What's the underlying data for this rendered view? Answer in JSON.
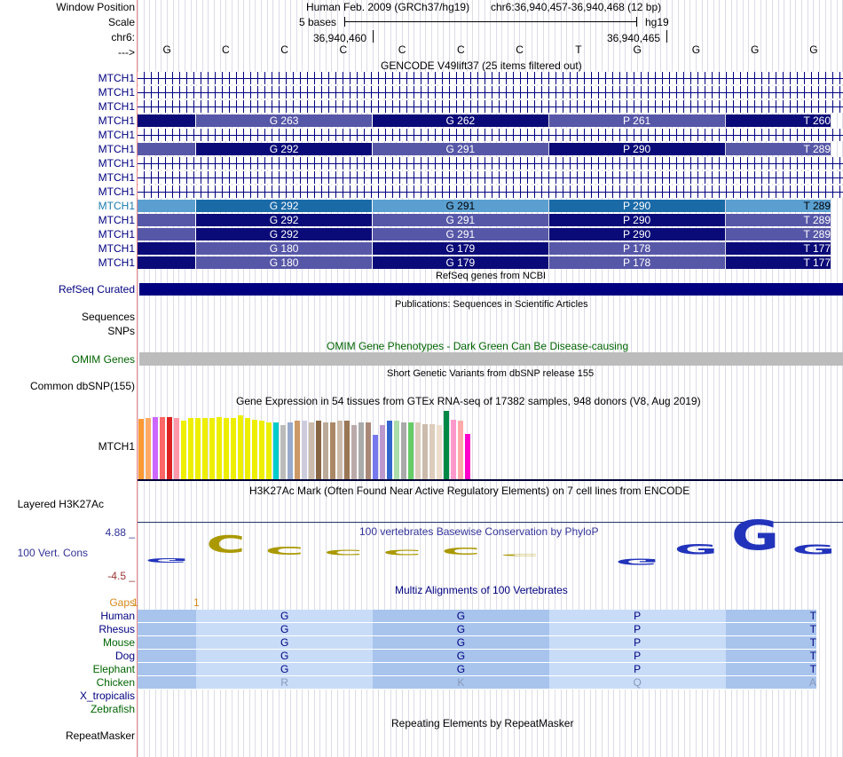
{
  "header": {
    "window_position_label": "Window Position",
    "scale_label": "Scale",
    "chrom_label": "chr6:",
    "arrow_label": "--->",
    "assembly_title": "Human Feb. 2009 (GRCh37/hg19)",
    "position_range": "chr6:36,940,457-36,940,468 (12 bp)",
    "scale_text": "5 bases",
    "assembly_short": "hg19",
    "coord_left": "36,940,460",
    "coord_right": "36,940,465"
  },
  "bases": [
    "G",
    "C",
    "C",
    "C",
    "C",
    "C",
    "C",
    "T",
    "G",
    "G",
    "G",
    "G"
  ],
  "gencode": {
    "title": "GENCODE V49lift37 (25 items filtered out)",
    "rows": [
      {
        "label": "MTCH1",
        "kind": "arrows"
      },
      {
        "label": "MTCH1",
        "kind": "arrows"
      },
      {
        "label": "MTCH1",
        "kind": "arrows"
      },
      {
        "label": "MTCH1",
        "kind": "codons",
        "codons": [
          "G 263",
          "G 262",
          "P 261",
          "T 260"
        ],
        "style": "darkfirst"
      },
      {
        "label": "MTCH1",
        "kind": "arrows"
      },
      {
        "label": "MTCH1",
        "kind": "codons",
        "codons": [
          "G 292",
          "G 291",
          "P 290",
          "T 289"
        ],
        "style": "lightfirst"
      },
      {
        "label": "MTCH1",
        "kind": "arrows"
      },
      {
        "label": "MTCH1",
        "kind": "arrows"
      },
      {
        "label": "MTCH1",
        "kind": "arrows"
      },
      {
        "label": "MTCH1",
        "kind": "codons",
        "codons": [
          "G 292",
          "G 291",
          "P 290",
          "T 289"
        ],
        "style": "highlight"
      },
      {
        "label": "MTCH1",
        "kind": "codons",
        "codons": [
          "G 292",
          "G 291",
          "P 290",
          "T 289"
        ],
        "style": "lightfirst"
      },
      {
        "label": "MTCH1",
        "kind": "codons",
        "codons": [
          "G 292",
          "G 291",
          "P 290",
          "T 289"
        ],
        "style": "lightfirst"
      },
      {
        "label": "MTCH1",
        "kind": "codons",
        "codons": [
          "G 180",
          "G 179",
          "P 178",
          "T 177"
        ],
        "style": "darkfirst"
      },
      {
        "label": "MTCH1",
        "kind": "codons",
        "codons": [
          "G 180",
          "G 179",
          "P 178",
          "T 177"
        ],
        "style": "darkfirst"
      }
    ]
  },
  "refseq": {
    "title": "RefSeq genes from NCBI",
    "label": "RefSeq Curated"
  },
  "publications": {
    "title": "Publications: Sequences in Scientific Articles",
    "label_sequences": "Sequences",
    "label_snps": "SNPs"
  },
  "omim": {
    "title": "OMIM Gene Phenotypes - Dark Green Can Be Disease-causing",
    "label": "OMIM Genes"
  },
  "dbsnp": {
    "title": "Short Genetic Variants from dbSNP release 155",
    "label": "Common dbSNP(155)"
  },
  "gtex": {
    "title": "Gene Expression in 54 tissues from GTEx RNA-seq of 17382 samples, 948 donors (V8, Aug 2019)",
    "label": "MTCH1",
    "bars": [
      {
        "c": "#ff9933",
        "v": 0.85
      },
      {
        "c": "#ffaa66",
        "v": 0.86
      },
      {
        "c": "#cc66ff",
        "v": 0.88
      },
      {
        "c": "#ff6666",
        "v": 0.88
      },
      {
        "c": "#dd2222",
        "v": 0.88
      },
      {
        "c": "#ff99aa",
        "v": 0.86
      },
      {
        "c": "#eeee00",
        "v": 0.82
      },
      {
        "c": "#eeee00",
        "v": 0.86
      },
      {
        "c": "#eeee00",
        "v": 0.86
      },
      {
        "c": "#eeee00",
        "v": 0.86
      },
      {
        "c": "#eeee00",
        "v": 0.86
      },
      {
        "c": "#eeee00",
        "v": 0.88
      },
      {
        "c": "#eeee00",
        "v": 0.86
      },
      {
        "c": "#eeee00",
        "v": 0.86
      },
      {
        "c": "#eeee00",
        "v": 0.9
      },
      {
        "c": "#eeee00",
        "v": 0.86
      },
      {
        "c": "#eeee00",
        "v": 0.84
      },
      {
        "c": "#eeee00",
        "v": 0.82
      },
      {
        "c": "#eeee00",
        "v": 0.8
      },
      {
        "c": "#00cccc",
        "v": 0.8
      },
      {
        "c": "#bbbbbb",
        "v": 0.76
      },
      {
        "c": "#99aacc",
        "v": 0.8
      },
      {
        "c": "#cc9966",
        "v": 0.82
      },
      {
        "c": "#ccccdd",
        "v": 0.82
      },
      {
        "c": "#ccbbaa",
        "v": 0.8
      },
      {
        "c": "#886644",
        "v": 0.82
      },
      {
        "c": "#bbaa99",
        "v": 0.8
      },
      {
        "c": "#aa8866",
        "v": 0.8
      },
      {
        "c": "#ccbbaa",
        "v": 0.82
      },
      {
        "c": "#997755",
        "v": 0.82
      },
      {
        "c": "#bbaaaa",
        "v": 0.76
      },
      {
        "c": "#aaaaaa",
        "v": 0.8
      },
      {
        "c": "#aa8877",
        "v": 0.8
      },
      {
        "c": "#7777ee",
        "v": 0.62
      },
      {
        "c": "#bb99cc",
        "v": 0.76
      },
      {
        "c": "#3366cc",
        "v": 0.82
      },
      {
        "c": "#aaddaa",
        "v": 0.82
      },
      {
        "c": "#aaaaaa",
        "v": 0.8
      },
      {
        "c": "#66cc66",
        "v": 0.8
      },
      {
        "c": "#ddccbb",
        "v": 0.8
      },
      {
        "c": "#ccbbaa",
        "v": 0.78
      },
      {
        "c": "#ddccbb",
        "v": 0.78
      },
      {
        "c": "#eeddcc",
        "v": 0.76
      },
      {
        "c": "#008844",
        "v": 0.96
      },
      {
        "c": "#ff99cc",
        "v": 0.84
      },
      {
        "c": "#ffaaaa",
        "v": 0.82
      },
      {
        "c": "#ff00cc",
        "v": 0.64
      }
    ]
  },
  "h3k27ac": {
    "title": "H3K27Ac Mark (Often Found Near Active Regulatory Elements) on 7 cell lines from ENCODE",
    "label": "Layered H3K27Ac"
  },
  "phylop": {
    "title": "100 vertebrates Basewise Conservation by PhyloP",
    "label": "100 Vert. Cons",
    "max_label": "4.88 _",
    "min_label": "-4.5 _",
    "logos": [
      {
        "ch": "G",
        "col": "#2233bb",
        "size": 0.25,
        "dir": "down"
      },
      {
        "ch": "C",
        "col": "#aa9900",
        "size": 1.0,
        "dir": "up"
      },
      {
        "ch": "C",
        "col": "#aa9900",
        "size": 0.45,
        "dir": "up"
      },
      {
        "ch": "C",
        "col": "#aa9900",
        "size": 0.3,
        "dir": "up"
      },
      {
        "ch": "C",
        "col": "#aa9900",
        "size": 0.3,
        "dir": "up"
      },
      {
        "ch": "C",
        "col": "#aa9900",
        "size": 0.4,
        "dir": "up"
      },
      {
        "ch": "C",
        "col": "#aa9900",
        "size": 0.05,
        "dir": "up"
      },
      {
        "ch": "T",
        "col": "#cc2222",
        "size": 0.0,
        "dir": "up"
      },
      {
        "ch": "G",
        "col": "#2233bb",
        "size": 0.35,
        "dir": "down"
      },
      {
        "ch": "G",
        "col": "#2233bb",
        "size": 0.6,
        "dir": "up"
      },
      {
        "ch": "G",
        "col": "#2233bb",
        "size": 1.7,
        "dir": "up"
      },
      {
        "ch": "G",
        "col": "#2233bb",
        "size": 0.55,
        "dir": "up"
      }
    ]
  },
  "multiz": {
    "title": "Multiz Alignments of 100 Vertebrates",
    "gaps_label": "Gaps",
    "gap_marks": [
      "1",
      "1"
    ],
    "species": [
      {
        "name": "Human",
        "col": "#000080",
        "aa": [
          "G",
          "G",
          "P",
          "T"
        ]
      },
      {
        "name": "Rhesus",
        "col": "#000080",
        "aa": [
          "G",
          "G",
          "P",
          "T"
        ]
      },
      {
        "name": "Mouse",
        "col": "#006400",
        "aa": [
          "G",
          "G",
          "P",
          "T"
        ]
      },
      {
        "name": "Dog",
        "col": "#000080",
        "aa": [
          "G",
          "G",
          "P",
          "T"
        ]
      },
      {
        "name": "Elephant",
        "col": "#006400",
        "aa": [
          "G",
          "G",
          "P",
          "T"
        ]
      },
      {
        "name": "Chicken",
        "col": "#006400",
        "aa": [
          "R",
          "K",
          "Q",
          "A"
        ]
      },
      {
        "name": "X_tropicalis",
        "col": "#000080",
        "aa": []
      },
      {
        "name": "Zebrafish",
        "col": "#006400",
        "aa": []
      }
    ]
  },
  "repeatmasker": {
    "title": "Repeating Elements by RepeatMasker",
    "label": "RepeatMasker"
  },
  "colors": {
    "navy": "#000080",
    "codon_dark": "#0a0a78",
    "codon_light": "#5757a8",
    "highlight_dark": "#1a6aa8",
    "highlight_light": "#5a9fd0",
    "omim_gray": "#bcbcbc",
    "multiz_dark": "#a8c4ec",
    "multiz_light": "#c8dcf8"
  }
}
